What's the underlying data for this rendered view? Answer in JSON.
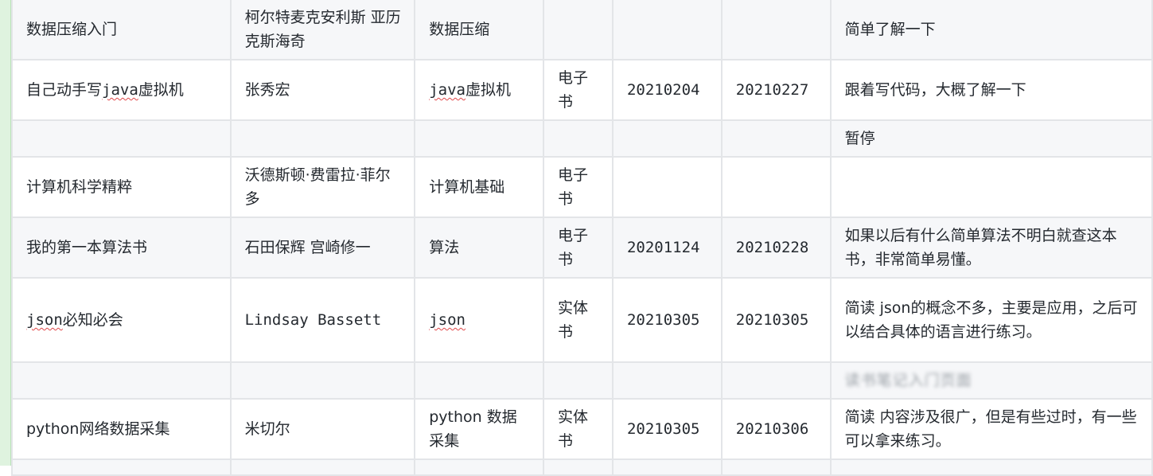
{
  "table": {
    "rows": [
      {
        "title": "数据压缩入门",
        "author": "柯尔特麦克安利斯 亚历克斯海奇",
        "category": "数据压缩",
        "format": "",
        "start": "",
        "end": "",
        "note": "简单了解一下"
      },
      {
        "title": "自己动手写java虚拟机",
        "author": "张秀宏",
        "category": "java虚拟机",
        "format": "电子书",
        "start": "20210204",
        "end": "20210227",
        "note": "跟着写代码，大概了解一下"
      },
      {
        "title": "",
        "author": "",
        "category": "",
        "format": "",
        "start": "",
        "end": "",
        "note": "暂停"
      },
      {
        "title": "计算机科学精粹",
        "author": "沃德斯顿·费雷拉·菲尔多",
        "category": "计算机基础",
        "format": "电子书",
        "start": "",
        "end": "",
        "note": ""
      },
      {
        "title": "我的第一本算法书",
        "author": "石田保辉 宫崎修一",
        "category": "算法",
        "format": "电子书",
        "start": "20201124",
        "end": "20210228",
        "note": "如果以后有什么简单算法不明白就查这本书，非常简单易懂。"
      },
      {
        "title": "json必知必会",
        "author": "Lindsay Bassett",
        "category": "json",
        "format": "实体书",
        "start": "20210305",
        "end": "20210305",
        "note": "简读 json的概念不多，主要是应用，之后可以结合具体的语言进行练习。"
      },
      {
        "title": "",
        "author": "",
        "category": "",
        "format": "",
        "start": "",
        "end": "",
        "note": "读书笔记入门页面"
      },
      {
        "title": "python网络数据采集",
        "author": "米切尔",
        "category": "python 数据采集",
        "format": "实体书",
        "start": "20210305",
        "end": "20210306",
        "note": "简读 内容涉及很广，但是有些过时，有一些可以拿来练习。"
      },
      {
        "title": "",
        "author": "",
        "category": "",
        "format": "",
        "start": "",
        "end": "",
        "note": ""
      }
    ]
  }
}
